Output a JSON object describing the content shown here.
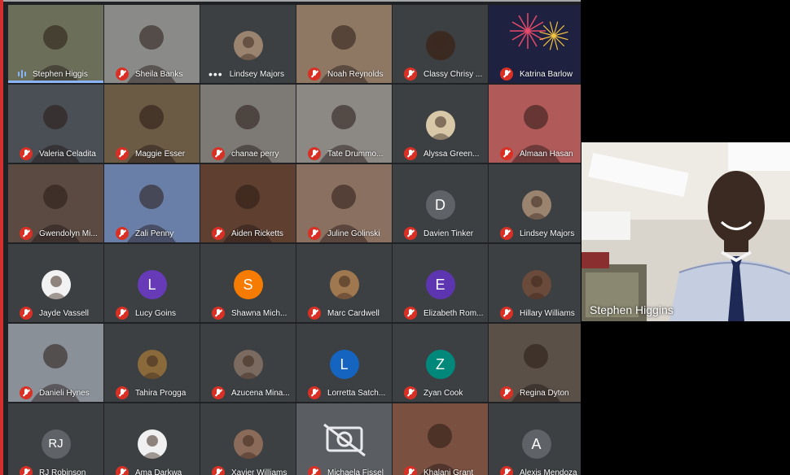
{
  "participants": [
    {
      "name": "Stephen Higgis",
      "state": "speaking",
      "bg": "#6b6f5a"
    },
    {
      "name": "Sheila Banks",
      "state": "muted",
      "bg": "#8a8a88"
    },
    {
      "name": "Lindsey Majors",
      "state": "more",
      "avatar": "photo",
      "avatar_color": "#9a8470"
    },
    {
      "name": "Noah Reynolds",
      "state": "muted",
      "bg": "#8e7864"
    },
    {
      "name": "Classy Chrisy ...",
      "state": "muted",
      "avatar": "photo",
      "avatar_color": "#3b2a22"
    },
    {
      "name": "Katrina Barlow",
      "state": "muted",
      "bg": "#2a2d4a",
      "image": "fireworks"
    },
    {
      "name": "Valeria Celadita",
      "state": "muted",
      "bg": "#4a4f55"
    },
    {
      "name": "Maggie Esser",
      "state": "muted",
      "bg": "#6b5a44"
    },
    {
      "name": "chanae perry",
      "state": "muted",
      "bg": "#7d7a76"
    },
    {
      "name": "Tate Drummo...",
      "state": "muted",
      "bg": "#8c8884"
    },
    {
      "name": "Alyssa Green...",
      "state": "muted",
      "avatar": "photo",
      "avatar_color": "#d8c8a8"
    },
    {
      "name": "Almaan Hasan",
      "state": "muted",
      "bg": "#b05a5a"
    },
    {
      "name": "Gwendolyn Mi...",
      "state": "muted",
      "bg": "#5a4a42"
    },
    {
      "name": "Zali Penny",
      "state": "muted",
      "bg": "#6a7fa8"
    },
    {
      "name": "Aiden Ricketts",
      "state": "muted",
      "bg": "#5f4030"
    },
    {
      "name": "Juline Golinski",
      "state": "muted",
      "bg": "#8a7060"
    },
    {
      "name": "Davien Tinker",
      "state": "muted",
      "avatar": "letter",
      "letter": "D",
      "avatar_color": "#5f6368"
    },
    {
      "name": "Lindsey Majors",
      "state": "muted",
      "avatar": "photo",
      "avatar_color": "#9a8470"
    },
    {
      "name": "Jayde Vassell",
      "state": "muted",
      "avatar": "photo",
      "avatar_color": "#f2f2f2"
    },
    {
      "name": "Lucy Goins",
      "state": "muted",
      "avatar": "letter",
      "letter": "L",
      "avatar_color": "#673ab7"
    },
    {
      "name": "Shawna Mich...",
      "state": "muted",
      "avatar": "letter",
      "letter": "S",
      "avatar_color": "#f57c00"
    },
    {
      "name": "Marc Cardwell",
      "state": "muted",
      "avatar": "photo",
      "avatar_color": "#a07850"
    },
    {
      "name": "Elizabeth Rom...",
      "state": "muted",
      "avatar": "letter",
      "letter": "E",
      "avatar_color": "#5e35b1"
    },
    {
      "name": "Hillary Williams",
      "state": "muted",
      "avatar": "photo",
      "avatar_color": "#6a4a3a"
    },
    {
      "name": "Danieli Hynes",
      "state": "muted",
      "bg": "#8a9098"
    },
    {
      "name": "Tahira Progga",
      "state": "muted",
      "avatar": "photo",
      "avatar_color": "#8a6a3a"
    },
    {
      "name": "Azucena Mina...",
      "state": "muted",
      "avatar": "photo",
      "avatar_color": "#7a6a60"
    },
    {
      "name": "Lorretta Satch...",
      "state": "muted",
      "avatar": "letter",
      "letter": "L",
      "avatar_color": "#1565c0"
    },
    {
      "name": "Zyan Cook",
      "state": "muted",
      "avatar": "letter",
      "letter": "Z",
      "avatar_color": "#00897b"
    },
    {
      "name": "Regina Dyton",
      "state": "muted",
      "bg": "#5a5048"
    },
    {
      "name": "RJ Robinson",
      "state": "muted",
      "avatar": "letter",
      "letter": "RJ",
      "avatar_color": "#5f6368"
    },
    {
      "name": "Ama Darkwa",
      "state": "muted",
      "avatar": "photo",
      "avatar_color": "#f0f0f0"
    },
    {
      "name": "Xavier Williams",
      "state": "muted",
      "avatar": "photo",
      "avatar_color": "#8a6a58"
    },
    {
      "name": "Michaela Fissel",
      "state": "muted",
      "bg": "#5a5e62",
      "image": "camera-off"
    },
    {
      "name": "Khalani Grant",
      "state": "muted",
      "bg": "#7a5040"
    },
    {
      "name": "Alexis Mendoza",
      "state": "muted",
      "avatar": "letter",
      "letter": "A",
      "avatar_color": "#5f6368"
    }
  ],
  "spotlight": {
    "name": "Stephen Higgins"
  },
  "colors": {
    "muted": "#d93025",
    "speaking": "#8ab4f8",
    "tile": "#3c4043",
    "grid": "#202124"
  }
}
